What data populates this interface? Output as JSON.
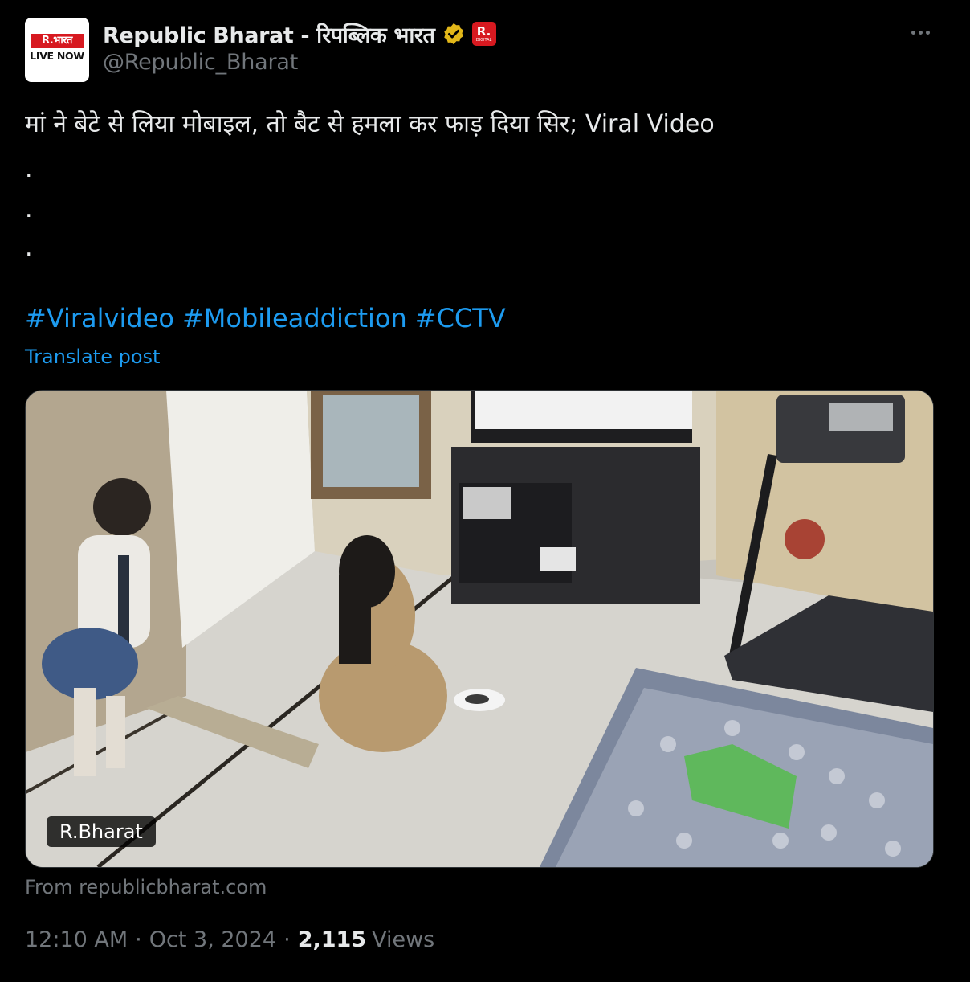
{
  "author": {
    "avatar_line1": "R.भारत",
    "avatar_line2": "LIVE NOW",
    "display_name": "Republic Bharat - रिपब्लिक भारत",
    "verified_icon": "gold-check-badge-icon",
    "affiliate_badge_top": "R.",
    "affiliate_badge_bottom": "DIGITAL",
    "handle": "@Republic_Bharat"
  },
  "more_icon": "ellipsis-icon",
  "post": {
    "text": "मां ने बेटे से लिया मोबाइल, तो बैट से हमला कर फाड़ दिया सिर; Viral Video",
    "dots": [
      ".",
      ".",
      "."
    ],
    "hashtags": [
      "#Viralvideo",
      "#Mobileaddiction",
      "#CCTV"
    ],
    "translate_label": "Translate post"
  },
  "media": {
    "badge": "R.Bharat",
    "source": "From republicbharat.com"
  },
  "meta": {
    "time": "12:10 AM",
    "date": "Oct 3, 2024",
    "separator": "·",
    "views_count": "2,115",
    "views_label": "Views"
  },
  "colors": {
    "background": "#000000",
    "text": "#e7e9ea",
    "secondary": "#71767b",
    "link": "#1d9bf0",
    "brand_red": "#d71920",
    "verified_gold": "#e2b719"
  }
}
